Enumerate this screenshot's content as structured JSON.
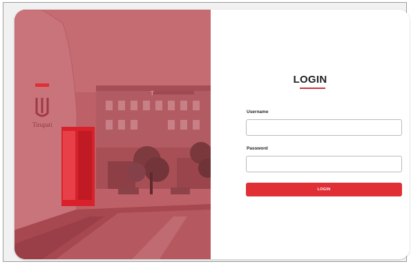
{
  "login": {
    "title": "LOGIN",
    "username_label": "Username",
    "username_value": "",
    "password_label": "Password",
    "password_value": "",
    "button_label": "LOGIN"
  },
  "campus": {
    "sign_text": "Tirupati",
    "building_sign": "T"
  },
  "colors": {
    "accent": "#e02f35",
    "underline": "#c9323d",
    "photo_overlay": "#b6555d",
    "facade_red": "#d9212b"
  }
}
